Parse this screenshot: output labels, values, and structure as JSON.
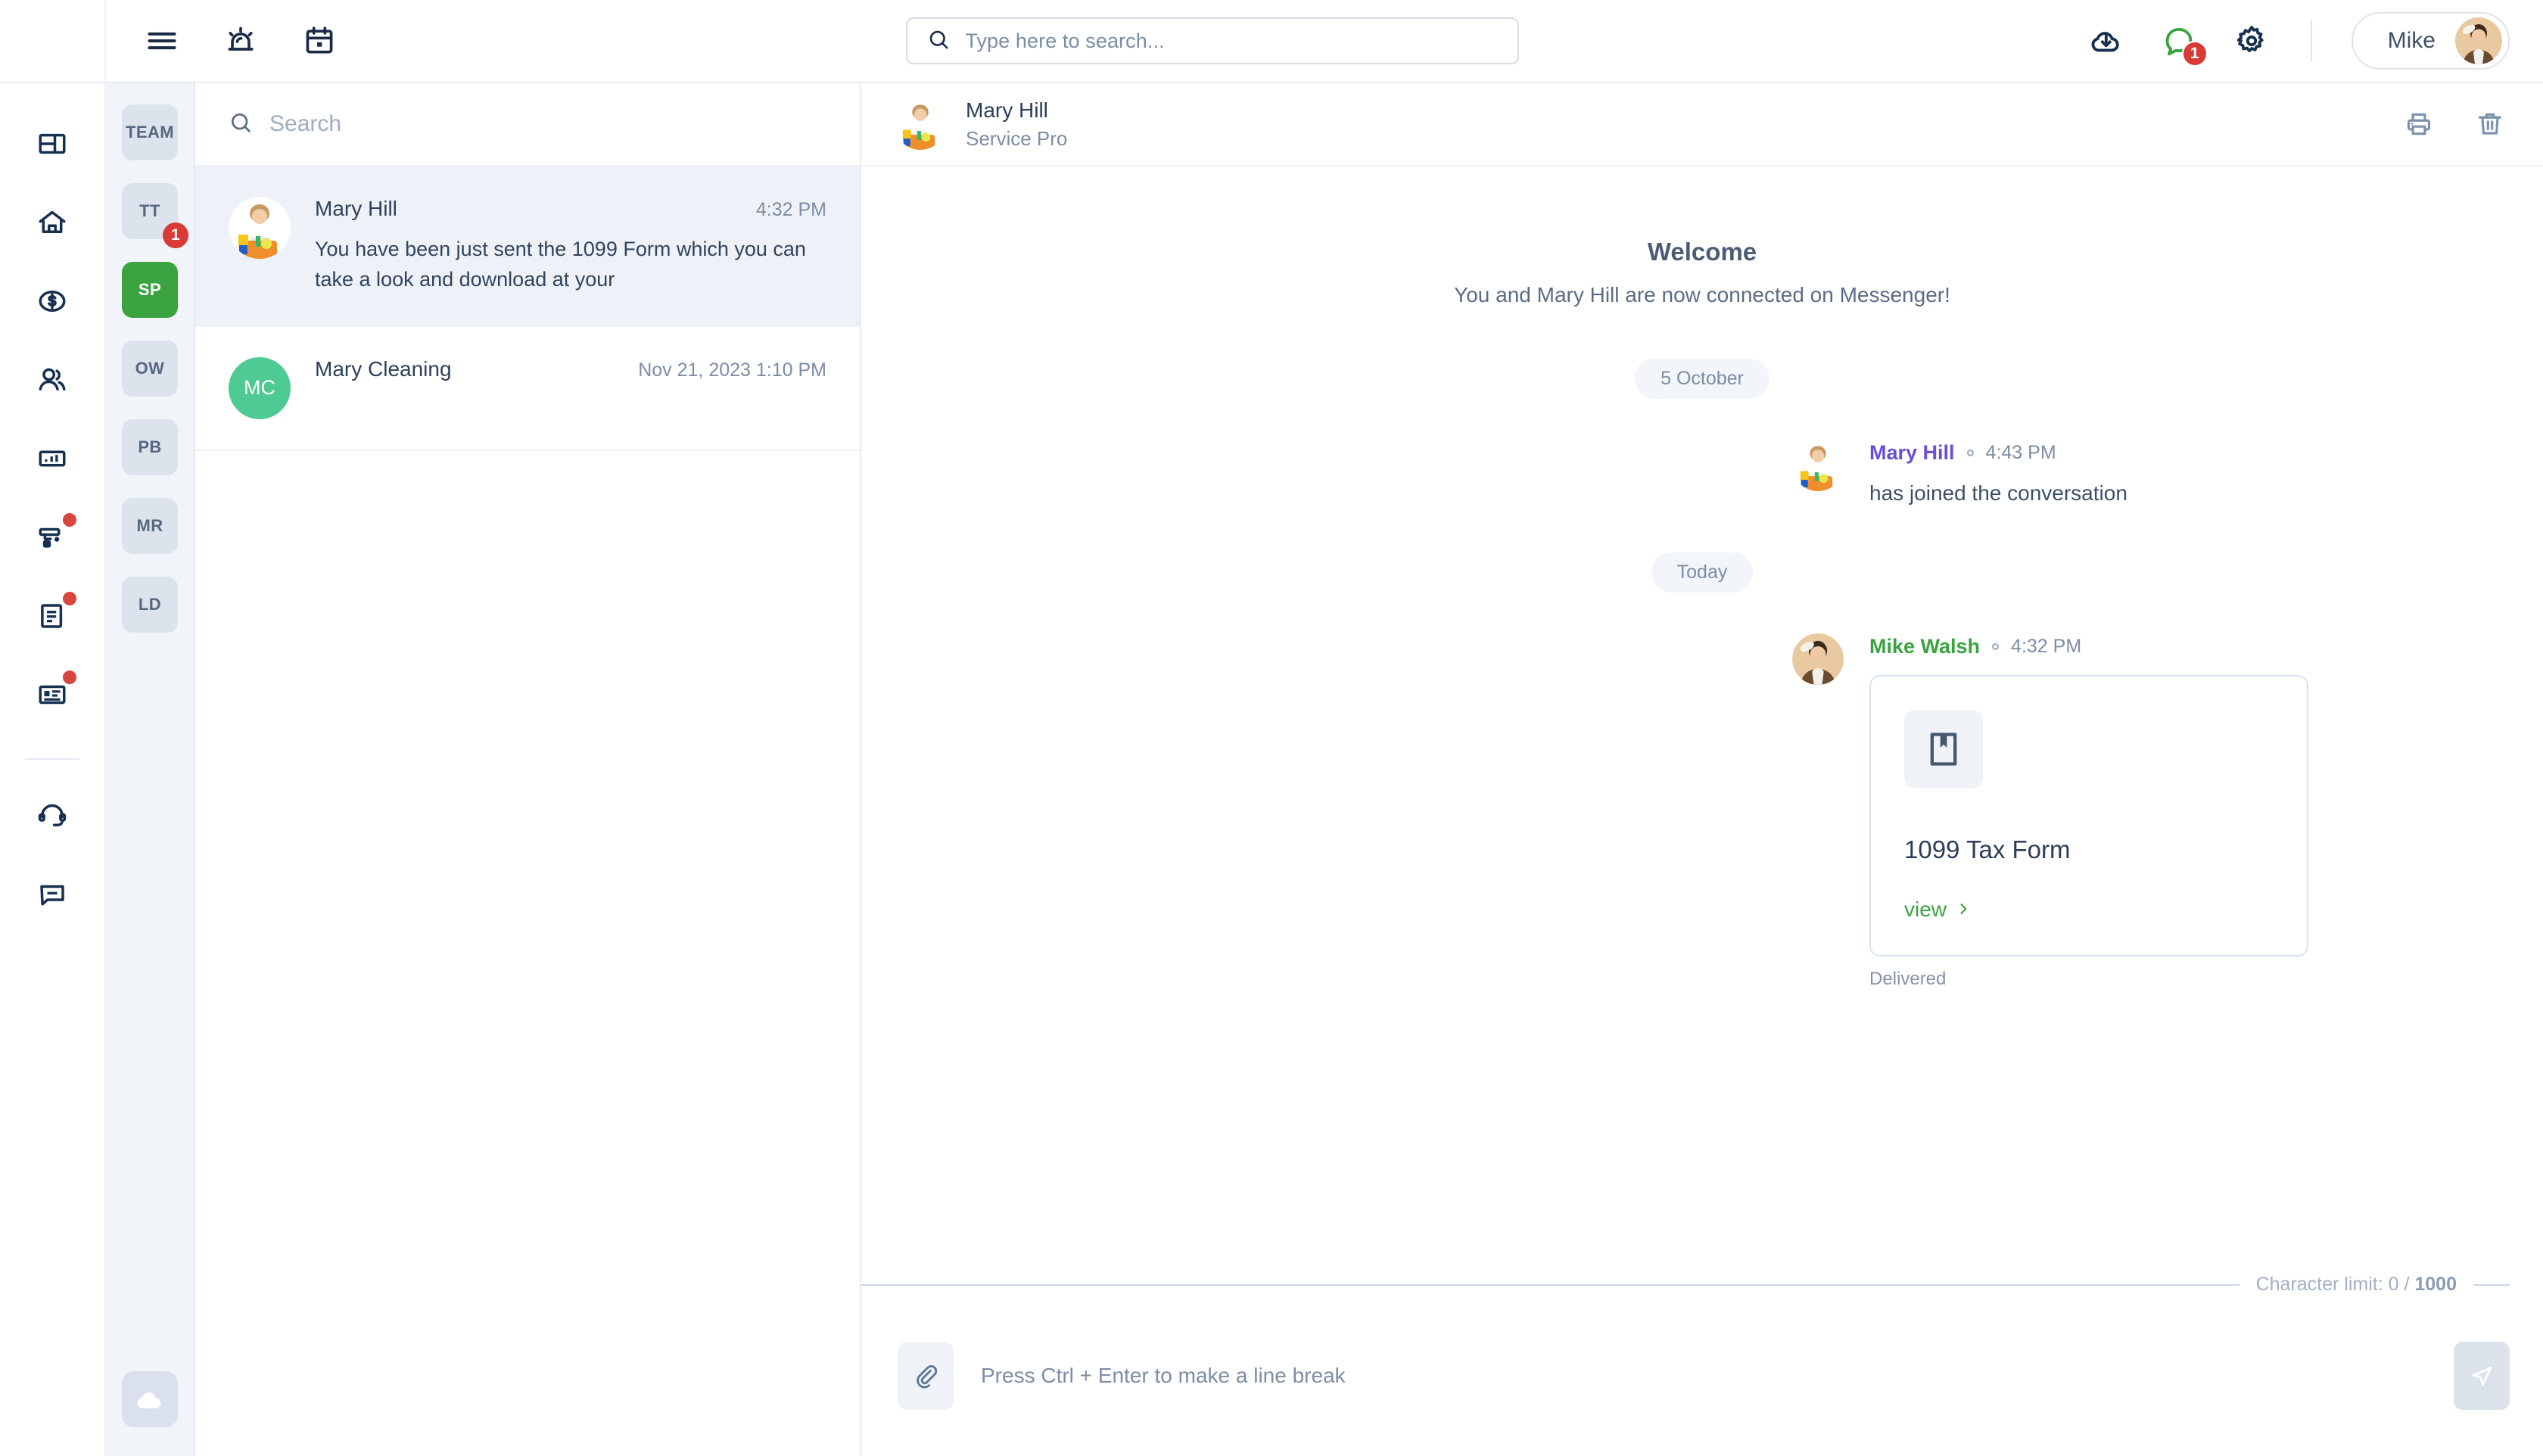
{
  "topbar": {
    "icons": [
      {
        "name": "hamburger-menu-icon",
        "label": "Menu"
      },
      {
        "name": "alarm-icon",
        "label": "Alerts"
      },
      {
        "name": "calendar-icon",
        "label": "Calendar"
      }
    ],
    "search": {
      "placeholder": "Type here to search..."
    },
    "download_icon": "cloud-download-icon",
    "messages_icon": "chat-bubble-icon",
    "messages_badge": "1",
    "settings_icon": "gear-icon",
    "user": {
      "name": "Mike"
    }
  },
  "rail": {
    "items": [
      {
        "name": "dashboard-icon",
        "label": "Dashboard",
        "dot": false
      },
      {
        "name": "home-icon",
        "label": "Home",
        "dot": false
      },
      {
        "name": "dollar-circle-icon",
        "label": "Billing",
        "dot": false
      },
      {
        "name": "people-icon",
        "label": "Customers",
        "dot": false
      },
      {
        "name": "bar-chart-icon",
        "label": "Reports",
        "dot": false
      },
      {
        "name": "paint-roller-icon",
        "label": "Jobs",
        "dot": true
      },
      {
        "name": "document-icon",
        "label": "Documents",
        "dot": true
      },
      {
        "name": "id-card-icon",
        "label": "Contacts",
        "dot": true
      }
    ],
    "bottom_items": [
      {
        "name": "headset-icon",
        "label": "Support"
      },
      {
        "name": "chat-icon",
        "label": "Messenger"
      }
    ]
  },
  "team_column": {
    "chips": [
      {
        "label": "TEAM",
        "active": false,
        "badge": null
      },
      {
        "label": "TT",
        "active": false,
        "badge": "1"
      },
      {
        "label": "SP",
        "active": true,
        "badge": null
      },
      {
        "label": "OW",
        "active": false,
        "badge": null
      },
      {
        "label": "PB",
        "active": false,
        "badge": null
      },
      {
        "label": "MR",
        "active": false,
        "badge": null
      },
      {
        "label": "LD",
        "active": false,
        "badge": null
      }
    ],
    "upload_icon": "cloud-upload-icon",
    "active_color": "#3aa340"
  },
  "conversation_list": {
    "search_placeholder": "Search",
    "items": [
      {
        "name": "Mary Hill",
        "time": "4:32 PM",
        "preview": "You have been just sent the 1099 Form which you can take a look and download at your",
        "selected": true,
        "avatar_type": "photo"
      },
      {
        "name": "Mary Cleaning",
        "time": "Nov 21, 2023 1:10 PM",
        "preview": "",
        "selected": false,
        "avatar_type": "initials",
        "initials": "MC",
        "initials_color": "#4ecb92"
      }
    ]
  },
  "thread": {
    "header": {
      "name": "Mary Hill",
      "subtitle": "Service Pro",
      "print_icon": "printer-icon",
      "delete_icon": "trash-icon"
    },
    "welcome": {
      "title": "Welcome",
      "subtitle": "You and Mary Hill are now connected on Messenger!"
    },
    "day_separators": [
      "5 October",
      "Today"
    ],
    "messages": [
      {
        "author": "Mary Hill",
        "author_color": "#6a4fd4",
        "time": "4:43 PM",
        "text": "has joined the conversation",
        "type": "text",
        "avatar_type": "photo-mary"
      },
      {
        "author": "Mike Walsh",
        "author_color": "#3aa340",
        "time": "4:32 PM",
        "type": "attachment",
        "avatar_type": "photo-mike",
        "attachment": {
          "icon": "bookmark-document-icon",
          "title": "1099 Tax Form",
          "link_label": "view",
          "link_color": "#3aa340"
        },
        "status": "Delivered"
      }
    ]
  },
  "composer": {
    "character_limit_prefix": "Character limit: 0 / ",
    "character_limit_max": "1000",
    "attach_icon": "paperclip-icon",
    "placeholder": "Press Ctrl + Enter to make a line break",
    "send_icon": "send-icon"
  }
}
